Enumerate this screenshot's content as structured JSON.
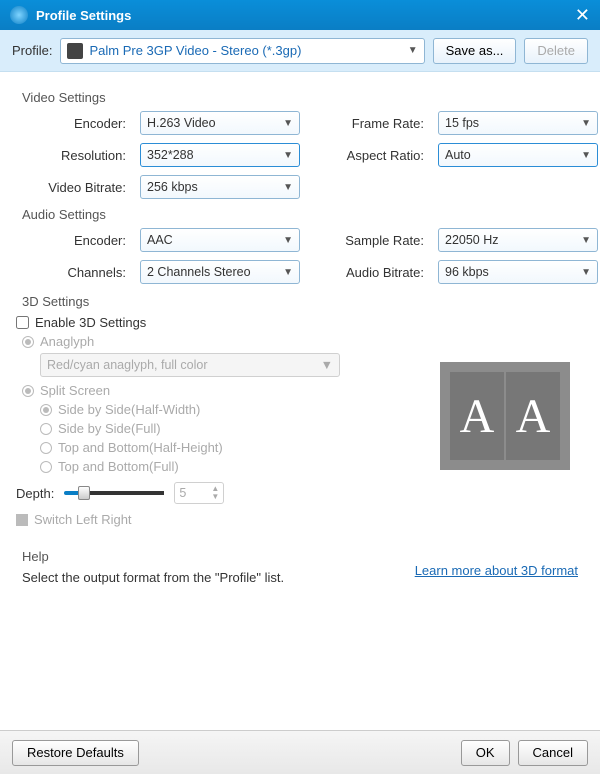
{
  "window": {
    "title": "Profile Settings"
  },
  "top": {
    "profile_label": "Profile:",
    "profile_value": "Palm Pre 3GP Video - Stereo (*.3gp)",
    "save_as": "Save as...",
    "delete": "Delete"
  },
  "video": {
    "section": "Video Settings",
    "encoder_label": "Encoder:",
    "encoder": "H.263 Video",
    "framerate_label": "Frame Rate:",
    "framerate": "15 fps",
    "resolution_label": "Resolution:",
    "resolution": "352*288",
    "aspect_label": "Aspect Ratio:",
    "aspect": "Auto",
    "bitrate_label": "Video Bitrate:",
    "bitrate": "256 kbps"
  },
  "audio": {
    "section": "Audio Settings",
    "encoder_label": "Encoder:",
    "encoder": "AAC",
    "samplerate_label": "Sample Rate:",
    "samplerate": "22050 Hz",
    "channels_label": "Channels:",
    "channels": "2 Channels Stereo",
    "bitrate_label": "Audio Bitrate:",
    "bitrate": "96 kbps"
  },
  "threeD": {
    "section": "3D Settings",
    "enable": "Enable 3D Settings",
    "anaglyph": "Anaglyph",
    "anaglyph_mode": "Red/cyan anaglyph, full color",
    "split": "Split Screen",
    "sbs_half": "Side by Side(Half-Width)",
    "sbs_full": "Side by Side(Full)",
    "tb_half": "Top and Bottom(Half-Height)",
    "tb_full": "Top and Bottom(Full)",
    "depth_label": "Depth:",
    "depth_value": "5",
    "switch_lr": "Switch Left Right",
    "learn_more": "Learn more about 3D format"
  },
  "help": {
    "section": "Help",
    "text": "Select the output format from the \"Profile\" list."
  },
  "footer": {
    "restore": "Restore Defaults",
    "ok": "OK",
    "cancel": "Cancel"
  }
}
